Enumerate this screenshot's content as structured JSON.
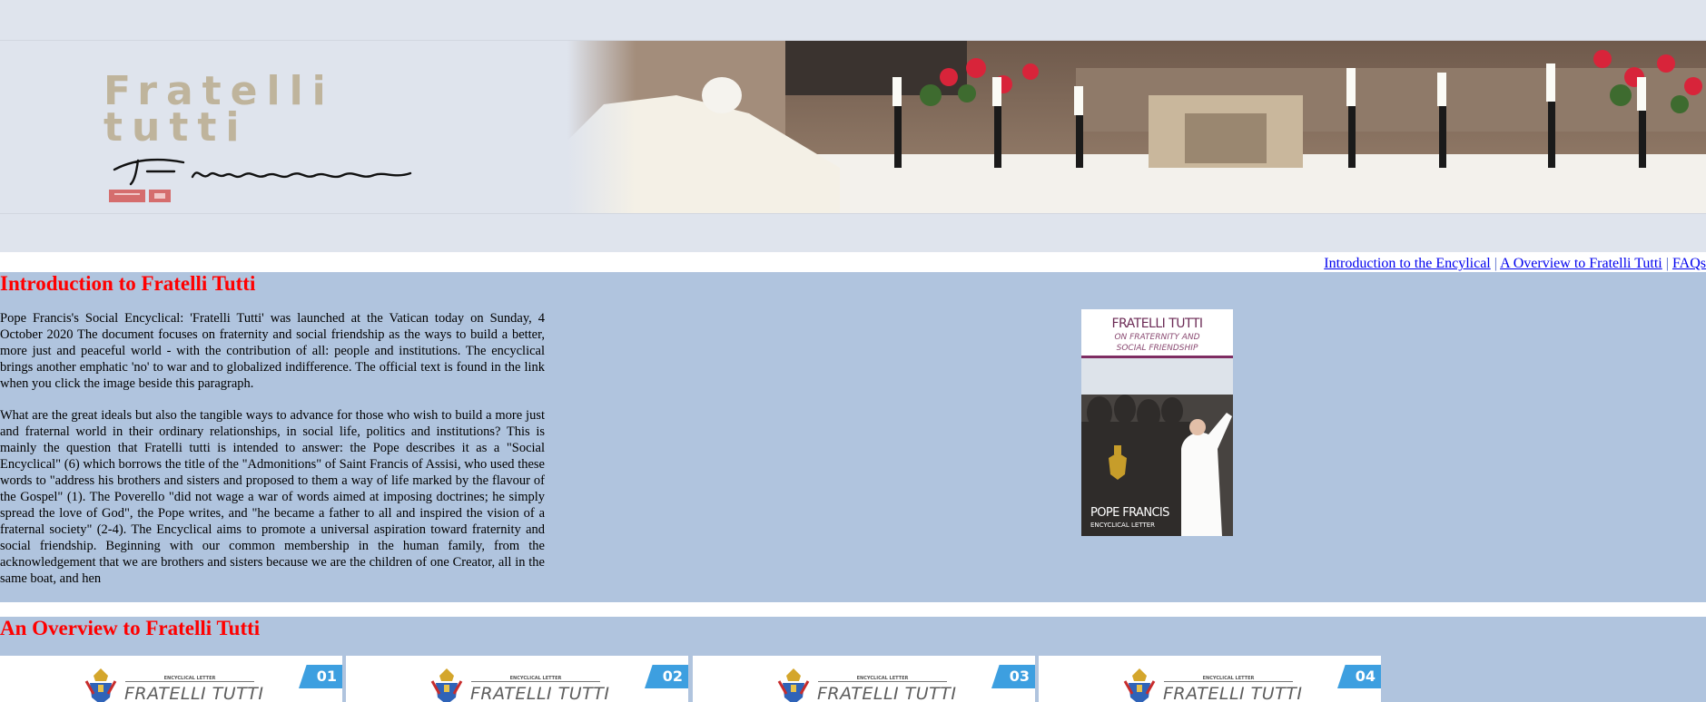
{
  "banner": {
    "title_line1": "Fratelli",
    "title_line2": "tutti",
    "signature": "Franciscus",
    "signature_icon": "signature-mark",
    "photo_icon": "pope-signing-photo"
  },
  "nav": {
    "links": [
      {
        "label": "Introduction to the Encylical"
      },
      {
        "label": "A Overview to Fratelli Tutti"
      },
      {
        "label": "FAQs"
      }
    ],
    "separator": "|"
  },
  "intro": {
    "heading": "Introduction to Fratelli Tutti",
    "paragraphs": [
      "Pope Francis's Social Encyclical: 'Fratelli Tutti' was launched at the Vatican today on Sunday, 4 October 2020 The document focuses on fraternity and social friendship as the ways to build a better, more just and peaceful world - with the contribution of all: people and institutions. The encyclical brings another emphatic 'no' to war and to globalized indifference. The official text is found in the link when you click the image beside this paragraph.",
      "What are the great ideals but also the tangible ways to advance for those who wish to build a more just and fraternal world in their ordinary relationships, in social life, politics and institutions? This is mainly the question that Fratelli tutti is intended to answer: the Pope describes it as a \"Social Encyclical\" (6) which borrows the title of the \"Admonitions\" of Saint Francis of Assisi, who used these words to \"address his brothers and sisters and proposed to them a way of life marked by the flavour of the Gospel\" (1). The Poverello \"did not wage a war of words aimed at imposing doctrines; he simply spread the love of God\", the Pope writes, and \"he became a father to all and inspired the vision of a fraternal society\" (2-4). The Encyclical aims to promote a universal aspiration toward fraternity and social friendship. Beginning with our common membership in the human family, from the acknowledgement that we are brothers and sisters because we are the children of one Creator, all in the same boat, and hen"
    ],
    "cover": {
      "title": "FRATELLI TUTTI",
      "subtitle_line1": "ON FRATERNITY AND",
      "subtitle_line2": "SOCIAL FRIENDSHIP",
      "author": "POPE FRANCIS",
      "kind": "ENCYCLICAL LETTER"
    }
  },
  "overview": {
    "heading": "An Overview to Fratelli Tutti",
    "cards": [
      {
        "label": "ENCYCLICAL LETTER",
        "title": "FRATELLI TUTTI",
        "number": "01"
      },
      {
        "label": "ENCYCLICAL LETTER",
        "title": "FRATELLI TUTTI",
        "number": "02"
      },
      {
        "label": "ENCYCLICAL LETTER",
        "title": "FRATELLI TUTTI",
        "number": "03"
      },
      {
        "label": "ENCYCLICAL LETTER",
        "title": "FRATELLI TUTTI",
        "number": "04"
      }
    ]
  },
  "colors": {
    "banner_bg": "#dfe4ed",
    "section_bg": "#b0c4de",
    "heading": "#ff0000",
    "link": "#0000ee",
    "card_badge": "#3d9fe0"
  }
}
